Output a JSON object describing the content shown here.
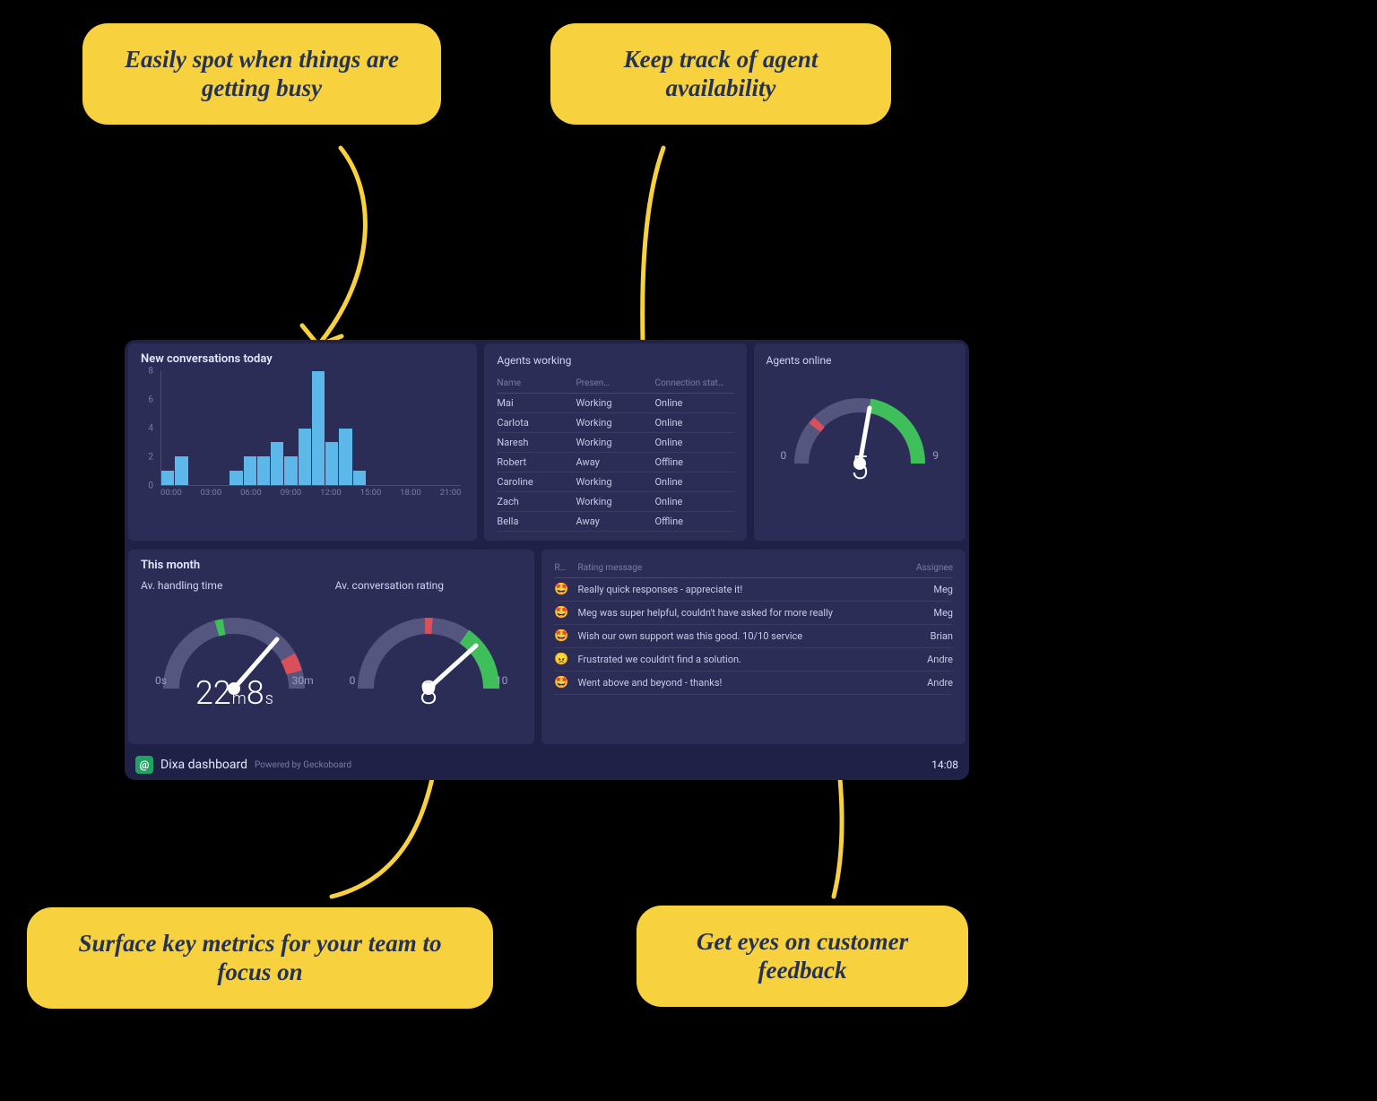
{
  "annotations": {
    "a1": "Easily spot when things are getting busy",
    "a2": "Keep track of agent availability",
    "a3": "Surface key metrics for your team to focus on",
    "a4": "Get eyes on customer feedback"
  },
  "top": {
    "new_conv_title": "New conversations today",
    "agents_working_title": "Agents working",
    "agents_online_title": "Agents online",
    "table_headers": {
      "name": "Name",
      "presence": "Presen…",
      "conn": "Connection stat…"
    },
    "agents": [
      {
        "name": "Mai",
        "presence": "Working",
        "conn": "Online"
      },
      {
        "name": "Carlota",
        "presence": "Working",
        "conn": "Online"
      },
      {
        "name": "Naresh",
        "presence": "Working",
        "conn": "Online"
      },
      {
        "name": "Robert",
        "presence": "Away",
        "conn": "Offline"
      },
      {
        "name": "Caroline",
        "presence": "Working",
        "conn": "Online"
      },
      {
        "name": "Zach",
        "presence": "Working",
        "conn": "Online"
      },
      {
        "name": "Bella",
        "presence": "Away",
        "conn": "Offline"
      }
    ],
    "online_gauge": {
      "min": "0",
      "max": "9",
      "value": "5"
    }
  },
  "bottom": {
    "month_title": "This month",
    "handling_title": "Av. handling time",
    "rating_title": "Av. conversation rating",
    "handling_gauge": {
      "min": "0s",
      "max": "30m",
      "value_html": "22m8s",
      "value_m": "22",
      "value_s": "8"
    },
    "rating_gauge": {
      "min": "0",
      "max": "10",
      "value": "8"
    },
    "fb_headers": {
      "r": "R…",
      "msg": "Rating message",
      "assignee": "Assignee"
    },
    "feedback": [
      {
        "emoji": "🤩",
        "msg": "Really quick responses - appreciate it!",
        "assignee": "Meg"
      },
      {
        "emoji": "🤩",
        "msg": "Meg was super helpful, couldn't have asked for more really",
        "assignee": "Meg"
      },
      {
        "emoji": "🤩",
        "msg": "Wish our own support was this good. 10/10 service",
        "assignee": "Brian"
      },
      {
        "emoji": "😠",
        "msg": "Frustrated we couldn't find a solution.",
        "assignee": "Andre"
      },
      {
        "emoji": "🤩",
        "msg": "Went above and beyond - thanks!",
        "assignee": "Andre"
      }
    ]
  },
  "footer": {
    "name": "Dixa dashboard",
    "powered": "Powered by Geckoboard",
    "time": "14:08"
  },
  "chart_data": {
    "type": "bar",
    "title": "New conversations today",
    "xlabel": "",
    "ylabel": "",
    "ylim": [
      0,
      8
    ],
    "categories": [
      "00:00",
      "01:00",
      "02:00",
      "03:00",
      "04:00",
      "05:00",
      "06:00",
      "07:00",
      "08:00",
      "09:00",
      "10:00",
      "11:00",
      "12:00",
      "13:00",
      "14:00",
      "15:00",
      "16:00",
      "17:00",
      "18:00",
      "19:00",
      "20:00",
      "21:00"
    ],
    "x_ticks": [
      "00:00",
      "03:00",
      "06:00",
      "09:00",
      "12:00",
      "15:00",
      "18:00",
      "21:00"
    ],
    "y_ticks": [
      0,
      2,
      4,
      6,
      8
    ],
    "values": [
      1,
      2,
      0,
      0,
      0,
      1,
      2,
      2,
      3,
      2,
      4,
      8,
      3,
      4,
      1,
      0,
      0,
      0,
      0,
      0,
      0,
      0
    ]
  }
}
